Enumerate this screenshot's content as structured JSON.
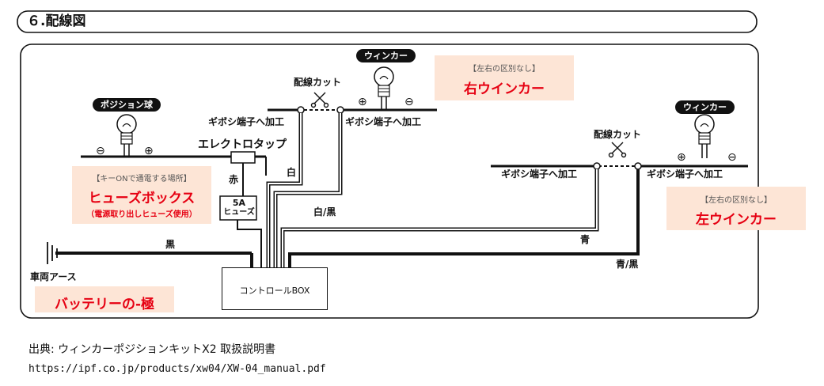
{
  "section_title": "６.配線図",
  "pills": {
    "position": "ポジション球",
    "winker_right": "ウィンカー",
    "winker_left": "ウィンカー"
  },
  "labels": {
    "cut_center": "配線カット",
    "cut_right": "配線カット",
    "gibosi_1": "ギボシ端子へ加工",
    "gibosi_2": "ギボシ端子へ加工",
    "gibosi_3": "ギボシ端子へ加工",
    "gibosi_4": "ギボシ端子へ加工",
    "electro_tap": "エレクトロタップ",
    "red": "赤",
    "white": "白",
    "white_black": "白/黒",
    "black": "黒",
    "blue": "青",
    "blue_black": "青/黒",
    "ground": "車両アース",
    "fuse_a": "5A",
    "fuse_b": "ヒューズ",
    "control_box": "コントロールBOX",
    "minus": "⊖",
    "plus": "⊕"
  },
  "notes": {
    "right_winker": {
      "small": "【左右の区別なし】",
      "big": "右ウインカー"
    },
    "left_winker": {
      "small": "【左右の区別なし】",
      "big": "左ウインカー"
    },
    "fuse_box": {
      "small": "【キーONで通電する場所】",
      "big": "ヒューズボックス",
      "sub": "（電源取り出しヒューズ使用）"
    },
    "battery": {
      "big": "バッテリーの-極"
    }
  },
  "credit": {
    "source": "出典: ウィンカーポジションキットX2 取扱説明書",
    "url": "https://ipf.co.jp/products/xw04/XW-04_manual.pdf"
  },
  "colors": {
    "accent_red": "#e60012",
    "note_bg": "#fde5d6",
    "wire": "#111111"
  }
}
